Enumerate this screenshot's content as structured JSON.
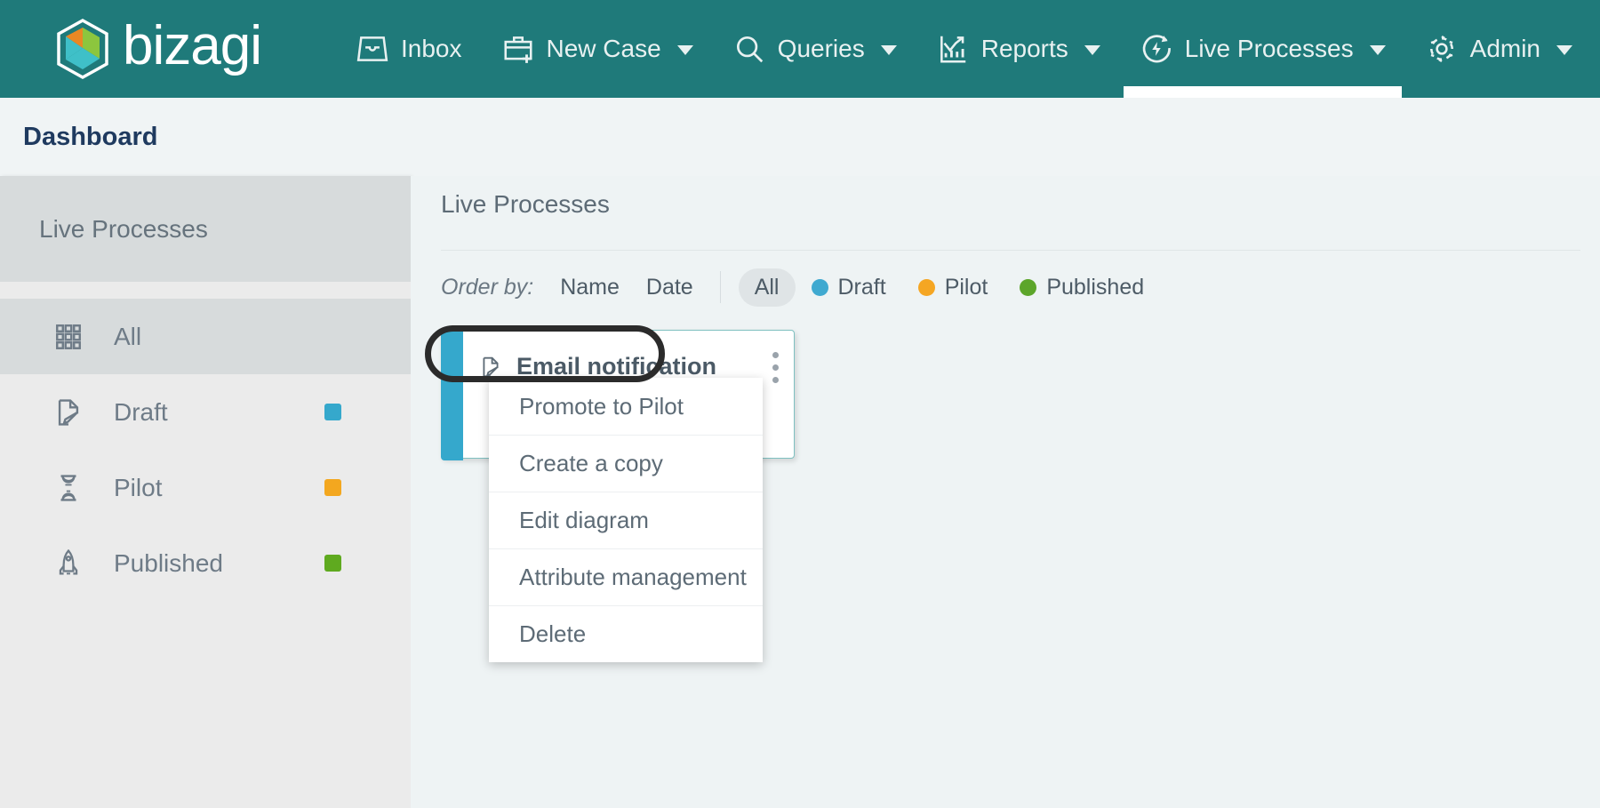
{
  "brand": {
    "name": "bizagi"
  },
  "topnav": {
    "items": [
      {
        "label": "Inbox",
        "icon": "inbox-icon",
        "caret": false,
        "active": false
      },
      {
        "label": "New Case",
        "icon": "briefcase-plus-icon",
        "caret": true,
        "active": false
      },
      {
        "label": "Queries",
        "icon": "search-icon",
        "caret": true,
        "active": false
      },
      {
        "label": "Reports",
        "icon": "chart-icon",
        "caret": true,
        "active": false
      },
      {
        "label": "Live Processes",
        "icon": "live-process-icon",
        "caret": true,
        "active": true
      },
      {
        "label": "Admin",
        "icon": "gear-icon",
        "caret": true,
        "active": false
      }
    ]
  },
  "titlebar": {
    "title": "Dashboard"
  },
  "sidebar": {
    "header": "Live Processes",
    "items": [
      {
        "label": "All",
        "icon": "grid-icon",
        "selected": true,
        "dot": null
      },
      {
        "label": "Draft",
        "icon": "page-edit-icon",
        "selected": false,
        "dot": "#35a8cc"
      },
      {
        "label": "Pilot",
        "icon": "hourglass-icon",
        "selected": false,
        "dot": "#f3a71f"
      },
      {
        "label": "Published",
        "icon": "rocket-icon",
        "selected": false,
        "dot": "#5faa1f"
      }
    ]
  },
  "main": {
    "heading": "Live Processes",
    "filterbar": {
      "order_by_label": "Order by:",
      "sorts": [
        "Name",
        "Date"
      ],
      "chips": [
        {
          "label": "All",
          "color": null,
          "active": true
        },
        {
          "label": "Draft",
          "color": "#3fa9d0",
          "active": false
        },
        {
          "label": "Pilot",
          "color": "#f5a623",
          "active": false
        },
        {
          "label": "Published",
          "color": "#5ca52a",
          "active": false
        }
      ]
    },
    "card": {
      "title": "Email notification",
      "status_color": "#35a8cc",
      "icon": "page-edit-icon"
    },
    "context_menu": {
      "items": [
        "Promote to Pilot",
        "Create a copy",
        "Edit diagram",
        "Attribute management",
        "Delete"
      ]
    }
  },
  "annotation": {
    "target": "Promote to Pilot",
    "shape": "oval",
    "color": "#2b2b2b"
  }
}
